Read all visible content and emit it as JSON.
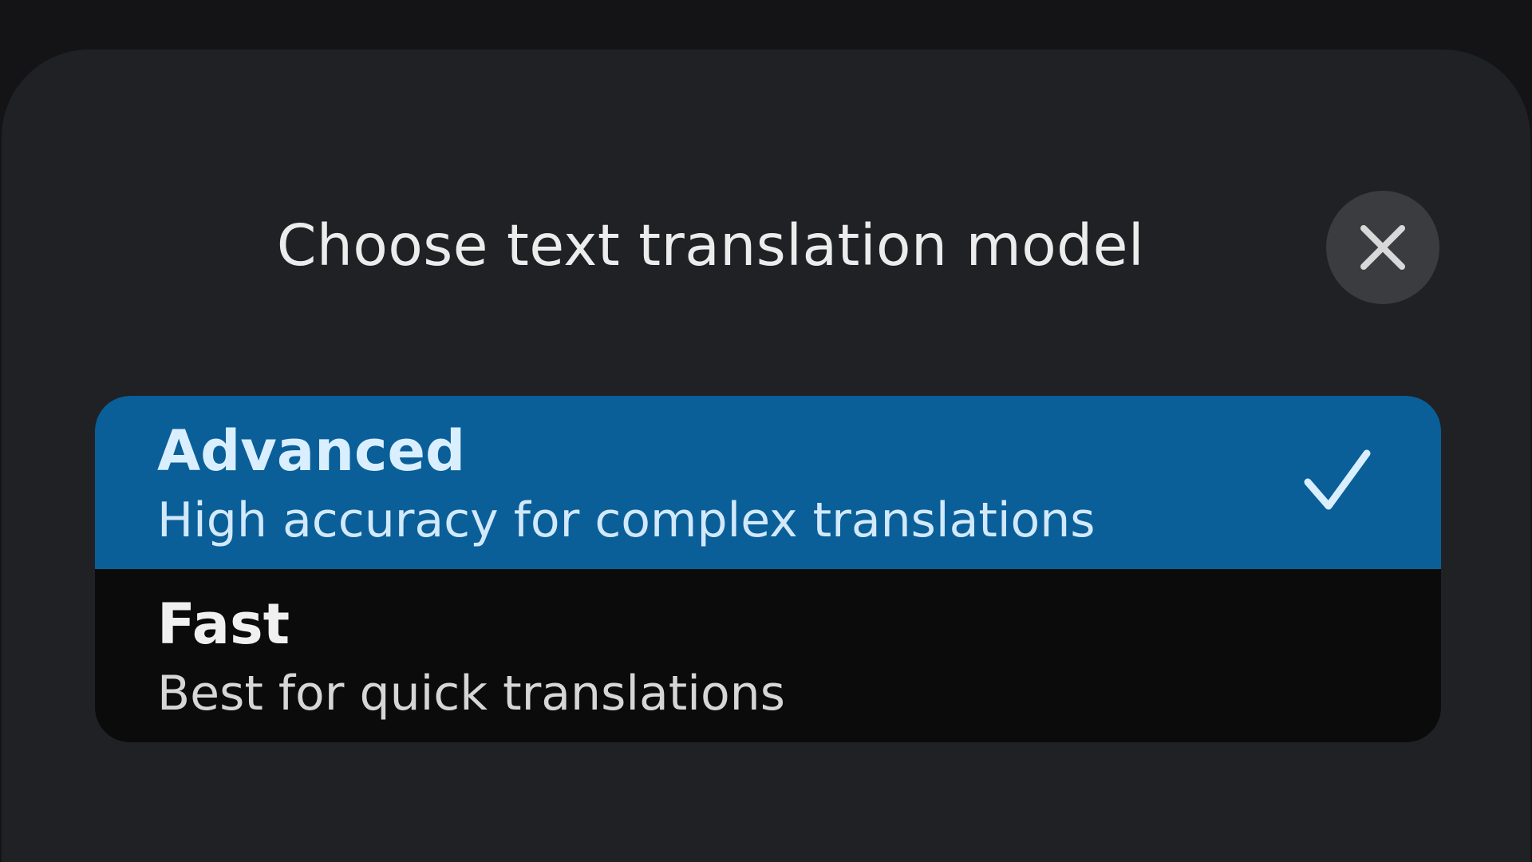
{
  "dialog": {
    "title": "Choose text translation model",
    "close_icon": "close-icon"
  },
  "options": [
    {
      "name": "Advanced",
      "description": "High accuracy for complex translations",
      "selected": true
    },
    {
      "name": "Fast",
      "description": "Best for quick translations",
      "selected": false
    }
  ],
  "colors": {
    "sheet_background": "#202124",
    "selected_background": "#0a5f98",
    "unselected_background": "#0b0b0c",
    "close_button_background": "#3b3c40"
  },
  "icons": {
    "selected_indicator": "checkmark-icon"
  }
}
